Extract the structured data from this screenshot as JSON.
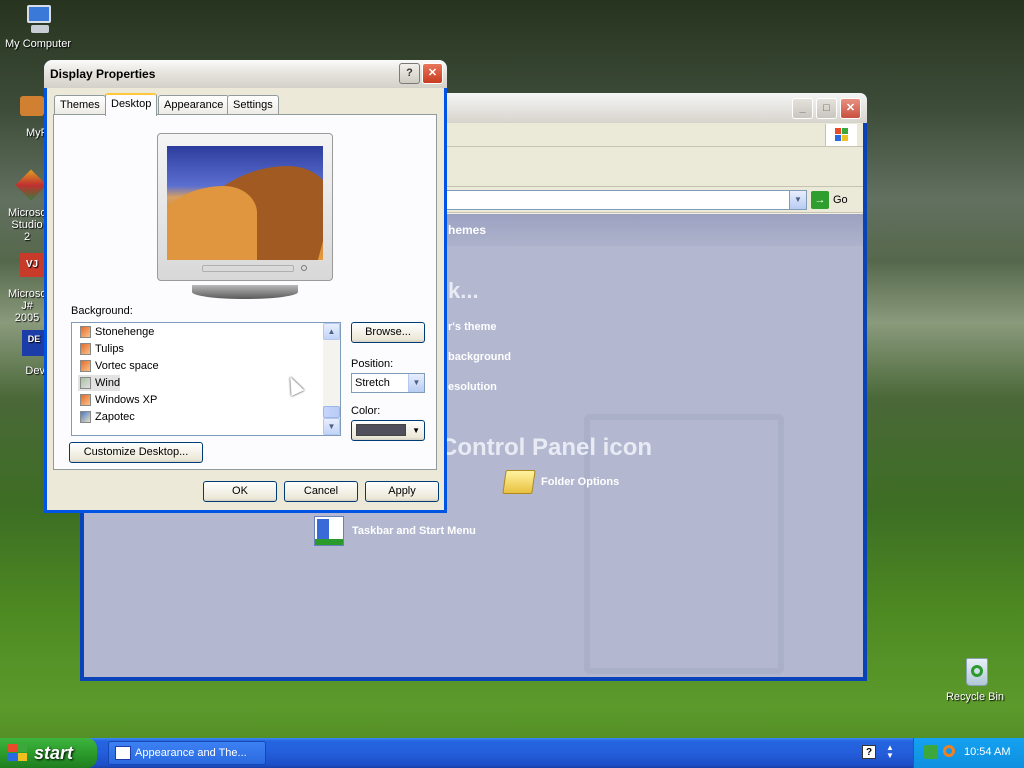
{
  "desktop": {
    "icons": [
      {
        "label": "My Computer"
      },
      {
        "label": "MyPa"
      },
      {
        "label": "Microsoft Studio 2"
      },
      {
        "label": "Microsoft J# 2005"
      },
      {
        "label": "Dev-C"
      },
      {
        "label": "Recycle Bin"
      }
    ]
  },
  "control_panel": {
    "address_go": "Go",
    "header_text": "hemes",
    "pick_task_text": "k...",
    "tasks": [
      "r's theme",
      "background",
      "esolution"
    ],
    "pick_icon_text": "Control Panel icon",
    "icons": [
      {
        "label": "Folder Options"
      },
      {
        "label": "Taskbar and Start Menu"
      }
    ]
  },
  "dialog": {
    "title": "Display Properties",
    "help_btn": "?",
    "close_btn": "✕",
    "tabs": [
      "Themes",
      "Desktop",
      "Appearance",
      "Settings"
    ],
    "active_tab": "Desktop",
    "background_label": "Background:",
    "backgrounds": [
      "Stonehenge",
      "Tulips",
      "Vortec space",
      "Wind",
      "Windows XP",
      "Zapotec"
    ],
    "selected_background": "Wind",
    "browse_btn": "Browse...",
    "position_label": "Position:",
    "position_value": "Stretch",
    "color_label": "Color:",
    "color_value": "#514f5c",
    "customize_btn": "Customize Desktop...",
    "ok_btn": "OK",
    "cancel_btn": "Cancel",
    "apply_btn": "Apply"
  },
  "taskbar": {
    "start_label": "start",
    "task_button": "Appearance and The...",
    "clock": "10:54 AM"
  }
}
